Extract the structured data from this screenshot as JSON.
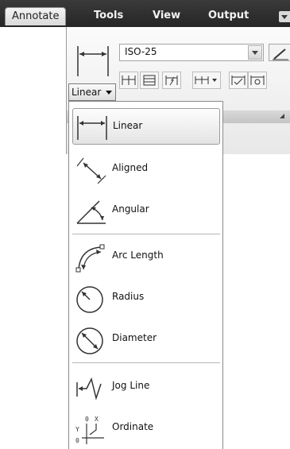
{
  "ribbon": {
    "tabs": [
      {
        "label": "Annotate",
        "active": true
      },
      {
        "label": "Tools",
        "active": false
      },
      {
        "label": "View",
        "active": false
      },
      {
        "label": "Output",
        "active": false
      }
    ]
  },
  "panel": {
    "dim_style_value": "ISO-25",
    "dimension_dropdown_label": "Linear"
  },
  "menu": {
    "items": [
      {
        "label": "Linear",
        "icon": "linear-dimension-icon",
        "selected": true
      },
      {
        "label": "Aligned",
        "icon": "aligned-dimension-icon",
        "selected": false
      },
      {
        "label": "Angular",
        "icon": "angular-dimension-icon",
        "selected": false
      },
      {
        "label": "Arc Length",
        "icon": "arc-length-icon",
        "selected": false
      },
      {
        "label": "Radius",
        "icon": "radius-icon",
        "selected": false
      },
      {
        "label": "Diameter",
        "icon": "diameter-icon",
        "selected": false
      },
      {
        "label": "Jog Line",
        "icon": "jog-line-icon",
        "selected": false
      },
      {
        "label": "Ordinate",
        "icon": "ordinate-icon",
        "selected": false
      }
    ]
  },
  "colors": {
    "tabbar_bg": "#2e2e2e",
    "panel_bg": "#f0f0f0",
    "menu_bg": "#ffffff",
    "selected_bg": "#e8e8e8"
  }
}
